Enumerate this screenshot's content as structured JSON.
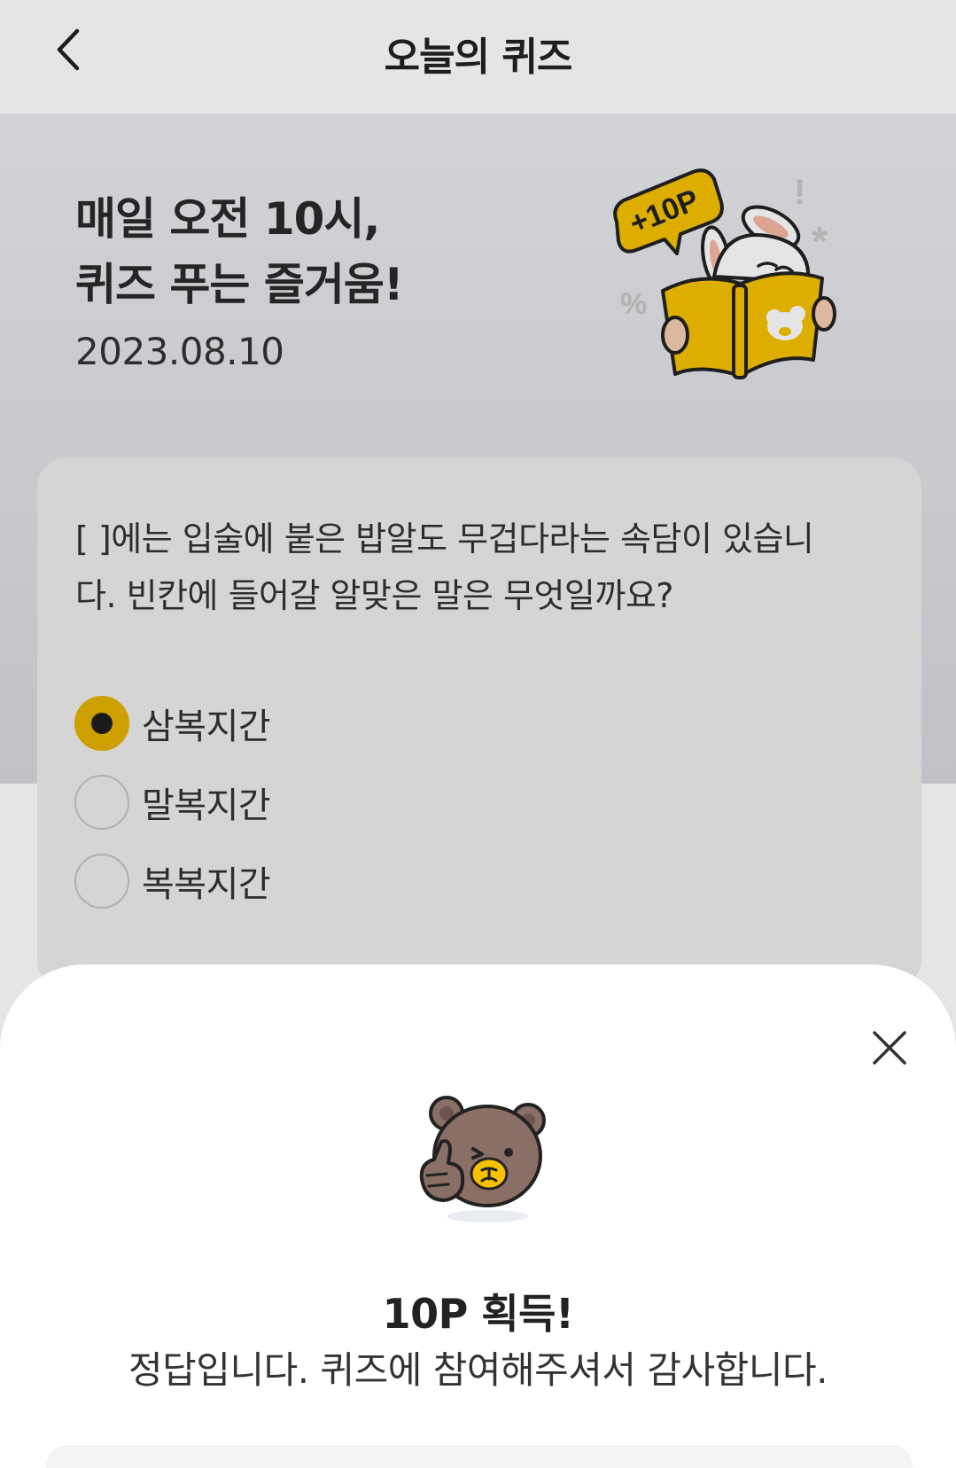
{
  "header": {
    "title": "오늘의 퀴즈",
    "back_icon": "chevron-left-icon"
  },
  "hero": {
    "title_line1": "매일 오전 10시,",
    "title_line2": "퀴즈 푸는 즐거움!",
    "date": "2023.08.10",
    "badge": "+10P"
  },
  "quiz": {
    "question_line1": "[ ]에는 입술에 붙은 밥알도 무겁다라는 속담이 있습니",
    "question_line2": "다. 빈칸에 들어갈 알맞은 말은 무엇일까요?",
    "options": [
      {
        "label": "삼복지간",
        "selected": true
      },
      {
        "label": "말복지간",
        "selected": false
      },
      {
        "label": "복복지간",
        "selected": false
      }
    ]
  },
  "result_sheet": {
    "close_icon": "close-icon",
    "title": "10P 획득!",
    "message": "정답입니다. 퀴즈에 참여해주셔서 감사합니다."
  },
  "colors": {
    "accent": "#e5b100",
    "hero_bg_top": "#e9ebef",
    "hero_bg_bottom": "#d7d9de",
    "bear_brown": "#8a6f66",
    "book_yellow": "#f6c200"
  }
}
